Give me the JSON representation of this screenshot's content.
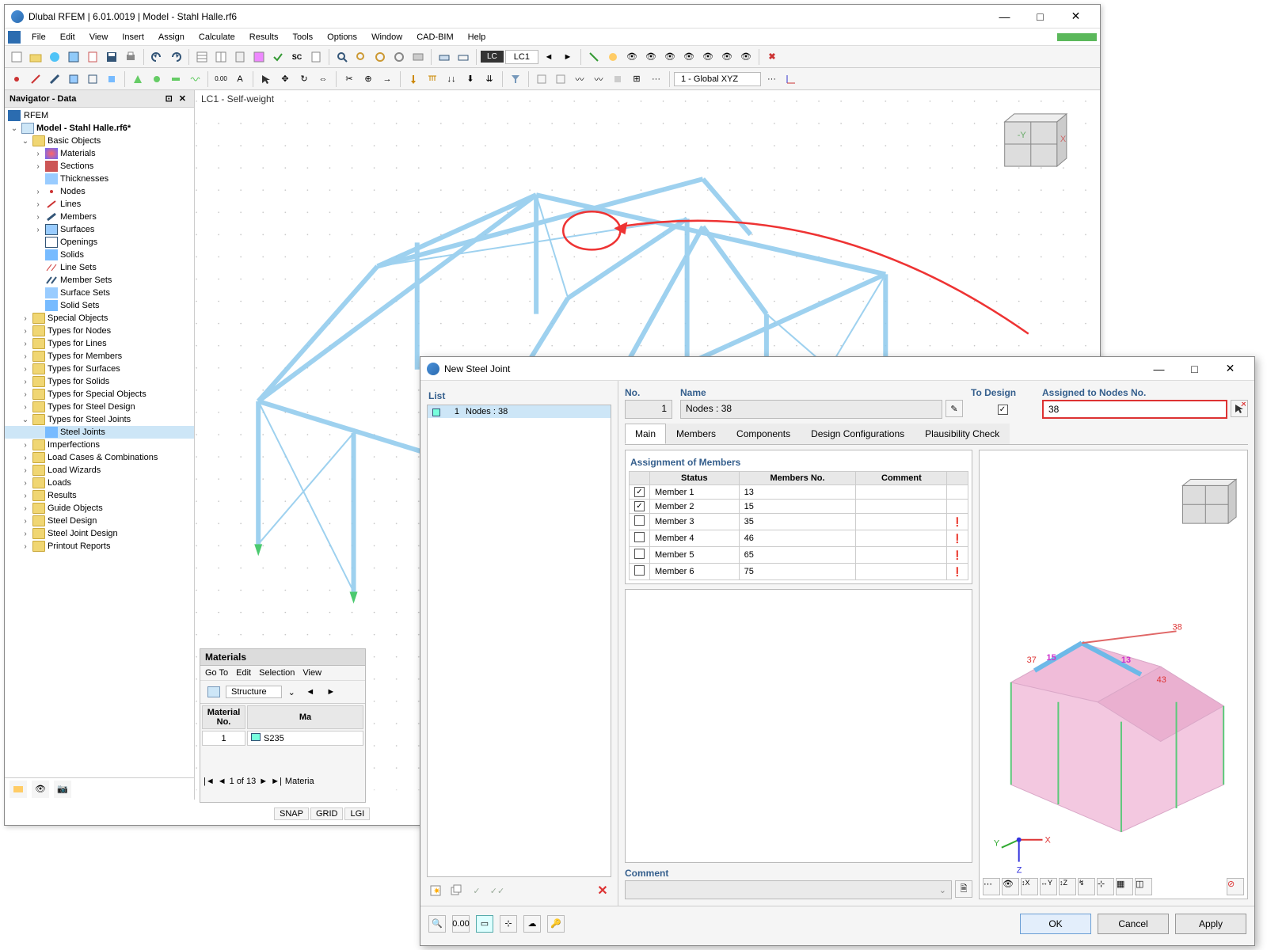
{
  "mainWindow": {
    "title": "Dlubal RFEM | 6.01.0019 | Model - Stahl Halle.rf6",
    "menus": [
      "File",
      "Edit",
      "View",
      "Insert",
      "Assign",
      "Calculate",
      "Results",
      "Tools",
      "Options",
      "Window",
      "CAD-BIM",
      "Help"
    ],
    "lcDropdown": "LC1",
    "coordSystem": "1 - Global XYZ"
  },
  "navigator": {
    "title": "Navigator - Data",
    "root": "RFEM",
    "model": "Model - Stahl Halle.rf6*",
    "basicObjects": {
      "label": "Basic Objects",
      "items": [
        "Materials",
        "Sections",
        "Thicknesses",
        "Nodes",
        "Lines",
        "Members",
        "Surfaces",
        "Openings",
        "Solids",
        "Line Sets",
        "Member Sets",
        "Surface Sets",
        "Solid Sets"
      ]
    },
    "otherGroups": [
      "Special Objects",
      "Types for Nodes",
      "Types for Lines",
      "Types for Members",
      "Types for Surfaces",
      "Types for Solids",
      "Types for Special Objects",
      "Types for Steel Design"
    ],
    "steelJointsGroup": "Types for Steel Joints",
    "steelJointsItem": "Steel Joints",
    "bottomGroups": [
      "Imperfections",
      "Load Cases & Combinations",
      "Load Wizards",
      "Loads",
      "Results",
      "Guide Objects",
      "Steel Design",
      "Steel Joint Design",
      "Printout Reports"
    ]
  },
  "viewport": {
    "caption": "LC1 - Self-weight"
  },
  "materials": {
    "title": "Materials",
    "menus": [
      "Go To",
      "Edit",
      "Selection",
      "View"
    ],
    "dropdown": "Structure",
    "colHeaders": [
      "Material No.",
      "Ma"
    ],
    "row": {
      "no": "1",
      "name": "S235"
    },
    "nav": "1 of 13",
    "navLabel": "Materia"
  },
  "statusbar": {
    "items": [
      "SNAP",
      "GRID",
      "LGI"
    ]
  },
  "dialog": {
    "title": "New Steel Joint",
    "list": {
      "label": "List",
      "itemNo": "1",
      "itemText": "Nodes : 38"
    },
    "fields": {
      "noLabel": "No.",
      "noValue": "1",
      "nameLabel": "Name",
      "nameValue": "Nodes : 38",
      "toDesignLabel": "To Design",
      "assignedLabel": "Assigned to Nodes No.",
      "assignedValue": "38"
    },
    "tabs": [
      "Main",
      "Members",
      "Components",
      "Design Configurations",
      "Plausibility Check"
    ],
    "members": {
      "title": "Assignment of Members",
      "headers": [
        "",
        "Status",
        "Members No.",
        "Comment"
      ],
      "rows": [
        {
          "checked": true,
          "status": "Member 1",
          "no": "13",
          "warn": false
        },
        {
          "checked": true,
          "status": "Member 2",
          "no": "15",
          "warn": false
        },
        {
          "checked": false,
          "status": "Member 3",
          "no": "35",
          "warn": true
        },
        {
          "checked": false,
          "status": "Member 4",
          "no": "46",
          "warn": true
        },
        {
          "checked": false,
          "status": "Member 5",
          "no": "65",
          "warn": true
        },
        {
          "checked": false,
          "status": "Member 6",
          "no": "75",
          "warn": true
        }
      ]
    },
    "commentLabel": "Comment",
    "previewLabels": {
      "n37": "37",
      "n38": "38",
      "n43": "43",
      "m13": "13",
      "m15": "15"
    },
    "buttons": {
      "ok": "OK",
      "cancel": "Cancel",
      "apply": "Apply"
    }
  }
}
